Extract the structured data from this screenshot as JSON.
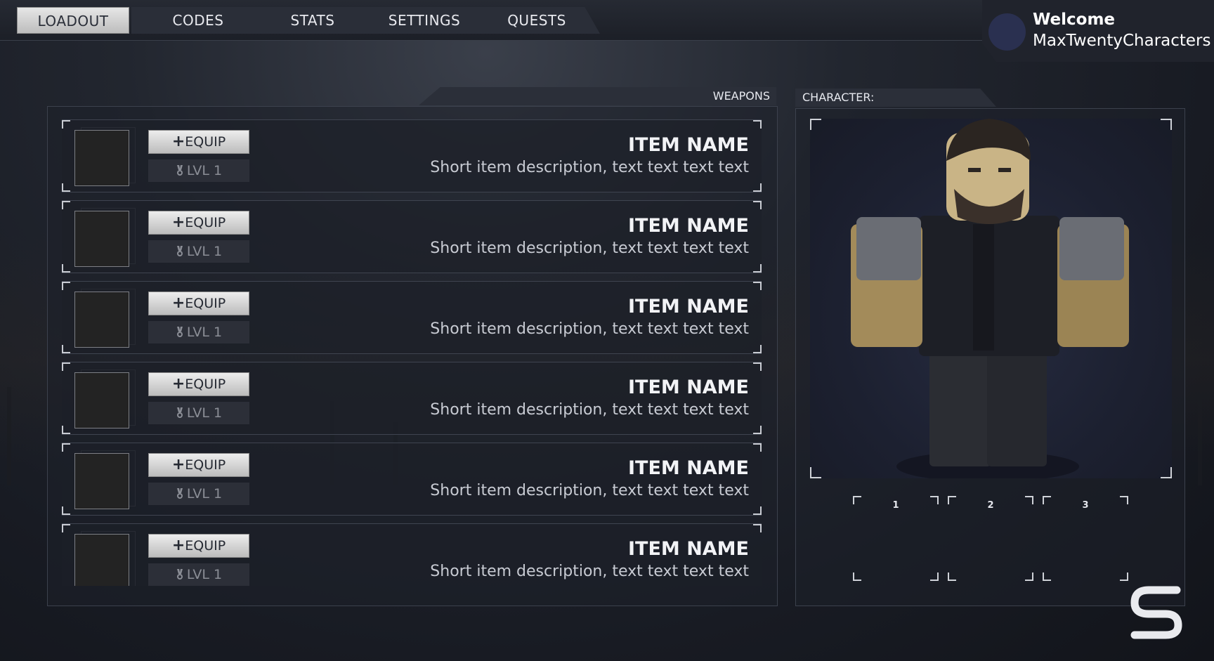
{
  "nav": {
    "tabs": [
      {
        "label": "LOADOUT",
        "active": true
      },
      {
        "label": "CODES",
        "active": false
      },
      {
        "label": "STATS",
        "active": false
      },
      {
        "label": "SETTINGS",
        "active": false
      },
      {
        "label": "QUESTS",
        "active": false
      }
    ]
  },
  "user": {
    "welcome": "Welcome",
    "name": "MaxTwentyCharacters"
  },
  "weapons": {
    "title": "WEAPONS",
    "items": [
      {
        "equip_label": "EQUIP",
        "level": "LVL 1",
        "name": "ITEM NAME",
        "description": "Short item description, text text text text"
      },
      {
        "equip_label": "EQUIP",
        "level": "LVL 1",
        "name": "ITEM NAME",
        "description": "Short item description, text text text text"
      },
      {
        "equip_label": "EQUIP",
        "level": "LVL 1",
        "name": "ITEM NAME",
        "description": "Short item description, text text text text"
      },
      {
        "equip_label": "EQUIP",
        "level": "LVL 1",
        "name": "ITEM NAME",
        "description": "Short item description, text text text text"
      },
      {
        "equip_label": "EQUIP",
        "level": "LVL 1",
        "name": "ITEM NAME",
        "description": "Short item description, text text text text"
      },
      {
        "equip_label": "EQUIP",
        "level": "LVL 1",
        "name": "ITEM NAME",
        "description": "Short item description, text text text text"
      }
    ]
  },
  "character": {
    "title": "CHARACTER:",
    "slots": [
      "1",
      "2",
      "3"
    ]
  },
  "icons": {
    "equip": "plus-icon",
    "level": "medal-icon",
    "logo": "s-logo-icon"
  },
  "colors": {
    "tab_active_bg": "#d6d6d6",
    "panel_border": "#3c414d",
    "background": "#1a1d25",
    "avatar": "#2a3050"
  }
}
